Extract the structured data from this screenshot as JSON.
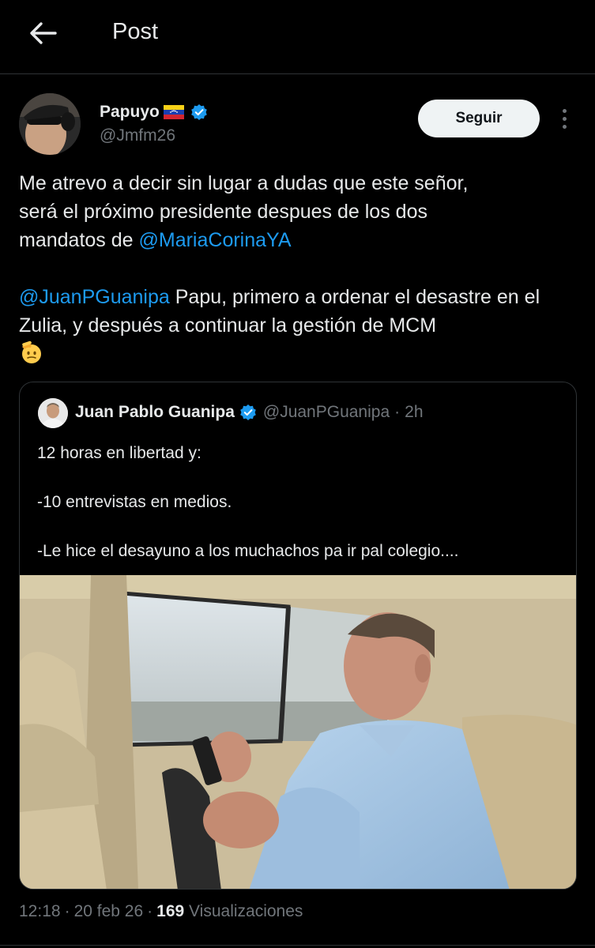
{
  "header": {
    "title": "Post"
  },
  "author": {
    "name": "Papuyo",
    "flag_icon": "venezuela-flag-icon",
    "handle": "@Jmfm26",
    "verified": true
  },
  "follow_label": "Seguir",
  "post": {
    "line1": "Me atrevo a decir sin lugar a dudas que este señor,",
    "line2": "será el próximo presidente despues de los dos",
    "line3_prefix": "mandatos de ",
    "mention1": "@MariaCorinaYA",
    "mention2": "@JuanPGuanipa",
    "para2_rest": " Papu, primero a ordenar el desastre en el Zulia, y después a continuar la gestión de MCM",
    "emoji": "saluting-face-emoji"
  },
  "quote": {
    "name": "Juan Pablo Guanipa",
    "handle": "@JuanPGuanipa",
    "dot": "·",
    "time": "2h",
    "line1": "12 horas en libertad y:",
    "line2": "-10 entrevistas en medios.",
    "line3": "-Le hice el desayuno a los muchachos pa ir pal colegio...."
  },
  "meta": {
    "time": "12:18",
    "sep": "·",
    "date": "20 feb 26",
    "views": "169",
    "views_label": "Visualizaciones"
  },
  "colors": {
    "background": "#000000",
    "text": "#e7e9ea",
    "muted": "#71767b",
    "link": "#1d9bf0",
    "border": "#2f3336"
  }
}
